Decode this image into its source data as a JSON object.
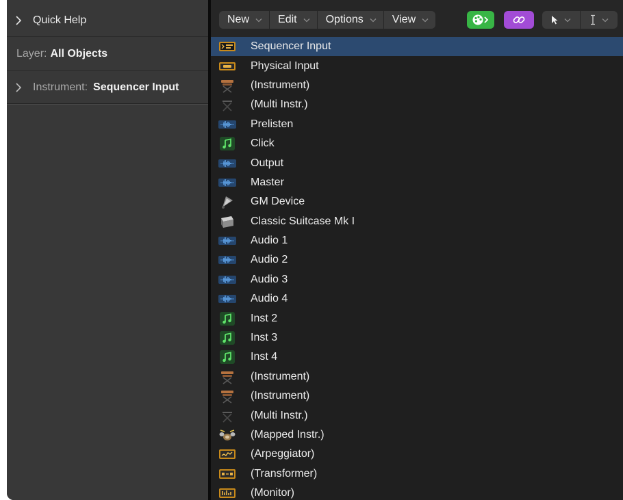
{
  "inspector": {
    "quick_help": "Quick Help",
    "layer_label": "Layer:",
    "layer_value": "All Objects",
    "instrument_label": "Instrument:",
    "instrument_value": "Sequencer Input"
  },
  "toolbar": {
    "new_label": "New",
    "edit_label": "Edit",
    "options_label": "Options",
    "view_label": "View",
    "accent_green": "#38b545",
    "accent_purple": "#a24cd6"
  },
  "objects": [
    {
      "label": "Sequencer Input",
      "icon": "sequencer-input-icon",
      "selected": true
    },
    {
      "label": "Physical Input",
      "icon": "physical-input-icon"
    },
    {
      "label": "(Instrument)",
      "icon": "keyboard-stand-icon"
    },
    {
      "label": "(Multi Instr.)",
      "icon": "stand-icon"
    },
    {
      "label": "Prelisten",
      "icon": "audio-waveform-icon"
    },
    {
      "label": "Click",
      "icon": "music-note-icon"
    },
    {
      "label": "Output",
      "icon": "audio-waveform-icon"
    },
    {
      "label": "Master",
      "icon": "audio-waveform-icon"
    },
    {
      "label": "GM Device",
      "icon": "gm-device-icon"
    },
    {
      "label": "Classic Suitcase Mk I",
      "icon": "electric-piano-icon"
    },
    {
      "label": "Audio 1",
      "icon": "audio-waveform-icon"
    },
    {
      "label": "Audio 2",
      "icon": "audio-waveform-icon"
    },
    {
      "label": "Audio 3",
      "icon": "audio-waveform-icon"
    },
    {
      "label": "Audio 4",
      "icon": "audio-waveform-icon"
    },
    {
      "label": "Inst 2",
      "icon": "music-note-icon"
    },
    {
      "label": "Inst 3",
      "icon": "music-note-icon"
    },
    {
      "label": "Inst 4",
      "icon": "music-note-icon"
    },
    {
      "label": "(Instrument)",
      "icon": "keyboard-stand-icon"
    },
    {
      "label": "(Instrument)",
      "icon": "keyboard-stand-icon"
    },
    {
      "label": "(Multi Instr.)",
      "icon": "stand-icon"
    },
    {
      "label": "(Mapped Instr.)",
      "icon": "drum-kit-icon"
    },
    {
      "label": "(Arpeggiator)",
      "icon": "arpeggiator-icon"
    },
    {
      "label": "(Transformer)",
      "icon": "transformer-icon"
    },
    {
      "label": "(Monitor)",
      "icon": "monitor-icon"
    }
  ]
}
